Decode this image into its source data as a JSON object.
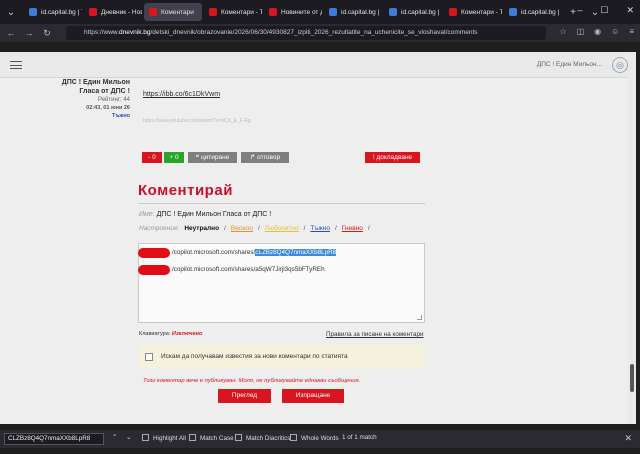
{
  "browser": {
    "tabs": [
      {
        "label": "id.capital.bg | Т",
        "color": "#3b7dd8",
        "active": false
      },
      {
        "label": "Дневник - Нов",
        "color": "#d8161f",
        "active": false
      },
      {
        "label": "Коментари",
        "color": "#d8161f",
        "active": true
      },
      {
        "label": "Коментари - Т",
        "color": "#d8161f",
        "active": false
      },
      {
        "label": "Новините от д",
        "color": "#d8161f",
        "active": false
      },
      {
        "label": "id.capital.bg |",
        "color": "#3b7dd8",
        "active": false
      },
      {
        "label": "id.capital.bg |",
        "color": "#3b7dd8",
        "active": false
      },
      {
        "label": "Коментари - Т",
        "color": "#d8161f",
        "active": false
      },
      {
        "label": "id.capital.bg |",
        "color": "#3b7dd8",
        "active": false
      }
    ],
    "url_prefix": "https://www.",
    "url_host": "dnevnik.bg",
    "url_path": "/detski_dnevnik/obrazovanie/2026/06/30/4930827_izpiti_2026_rezultatite_na_uchenicite_se_vloshavat/comments"
  },
  "site": {
    "user": "ДПС ! Един Мильон..."
  },
  "comment": {
    "author": "ДПС ! Един Мильон Гласа от ДПС !",
    "rating": "Рейтинг: 44",
    "date": "02:43, 01 юни 26",
    "here": "Тъжно",
    "link": "https://ibb.co/6c1DkVwm",
    "faded_link": "https://www.youtube.com/watch?v=bCX_E_F-Eg",
    "minus": "- 0",
    "plus": "+ 0",
    "quote": "цитиране",
    "reply": "отговор",
    "report": "докладване"
  },
  "form": {
    "heading": "Коментирай",
    "name_label": "Име:",
    "name_value": "ДПС ! Един Мильон Гласа от ДПС !",
    "mood_label": "Настроение:",
    "moods": [
      {
        "label": "Неутрално",
        "color": "#111111",
        "bold": true
      },
      {
        "label": "Весело",
        "color": "#e0932a",
        "bold": false
      },
      {
        "label": "Любопитно",
        "color": "#e6c22a",
        "bold": false
      },
      {
        "label": "Тъжно",
        "color": "#2a4db0",
        "bold": false
      },
      {
        "label": "Гневно",
        "color": "#d8161f",
        "bold": false
      }
    ],
    "line1_text": "/copilot.microsoft.com/shares/",
    "line1_highlight": "cLZBz8Q4Q7nmaXXb8LpR8",
    "line2_text": "/copilot.microsoft.com/shares/a5qW7Jirjl3qs5bFTyREh",
    "keyboard_label": "Клавиатура:",
    "keyboard_state": "Изключено",
    "rules_link": "Правила за писане на коментари",
    "notify_label": "Искам да получавам известия за нови коментари по статията",
    "warning": "Този коментар вече е публикуван. Моля, не публикувайте еднакви съобщения.",
    "preview_button": "Преглед",
    "send_button": "Изпращане"
  },
  "findbar": {
    "query": "CLZBz8Q4Q7nmaXXb8LpR8",
    "highlight_all": "Highlight All",
    "match_case": "Match Case",
    "match_diacritics": "Match Diacritics",
    "whole_words": "Whole Words",
    "result": "1 of 1 match"
  }
}
